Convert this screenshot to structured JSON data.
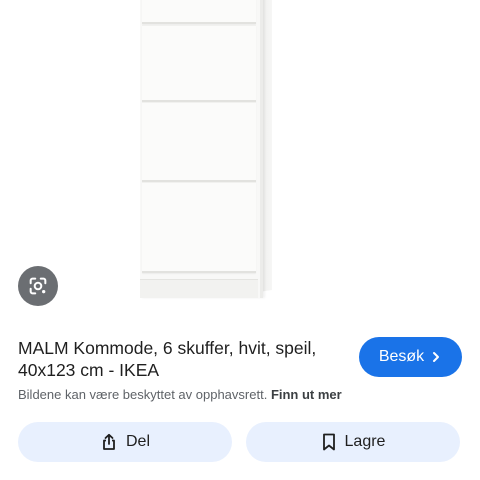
{
  "result": {
    "title": "MALM Kommode, 6 skuffer, hvit, speil, 40x123 cm - IKEA",
    "visit_label": "Besøk",
    "copyright_notice": "Bildene kan være beskyttet av opphavsrett.",
    "learn_more_label": "Finn ut mer"
  },
  "actions": {
    "share_label": "Del",
    "save_label": "Lagre"
  },
  "icons": {
    "lens": "google-lens-icon",
    "visit_arrow": "chevron-right-icon",
    "share": "share-icon",
    "save": "bookmark-icon"
  },
  "colors": {
    "accent": "#1a73e8",
    "action_button_bg": "#e8f0fe",
    "lens_button_bg": "#6b6e72"
  }
}
